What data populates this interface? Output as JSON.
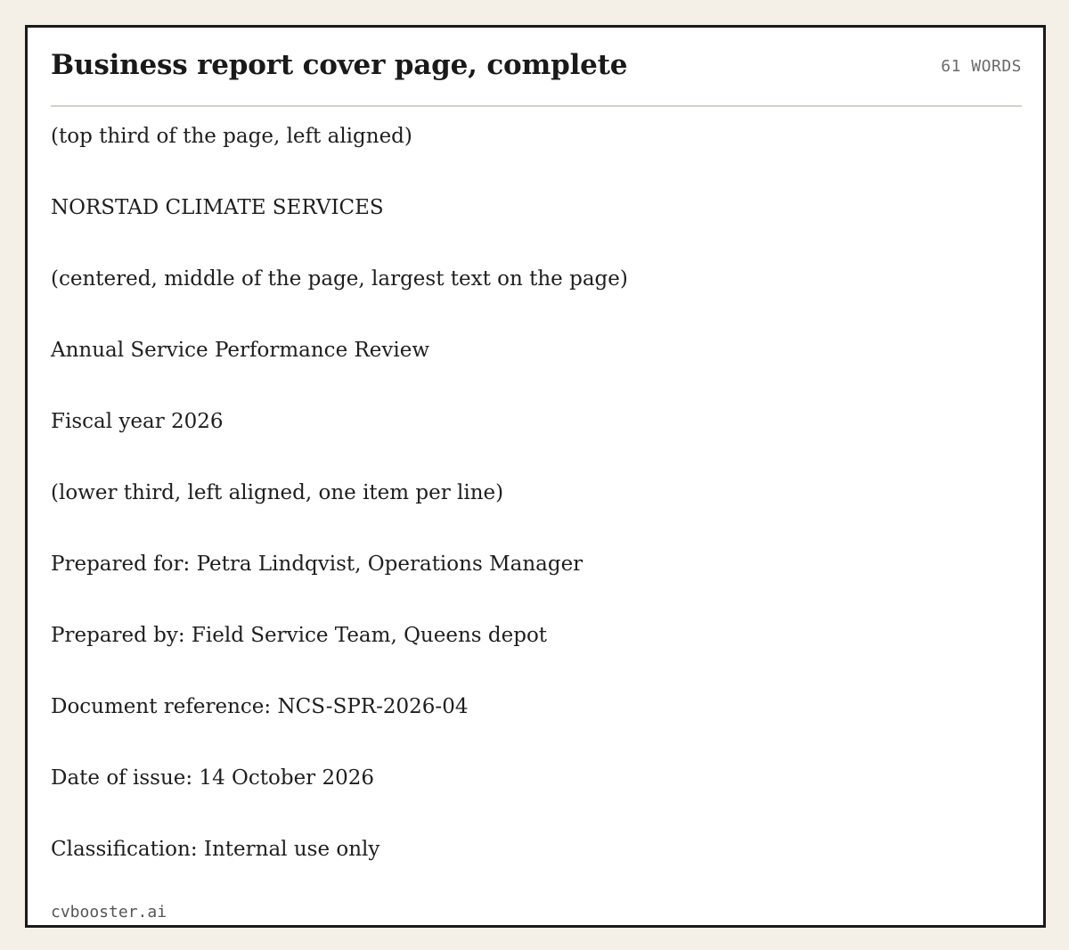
{
  "header": {
    "title": "Business report cover page, complete",
    "word_count": "61 WORDS"
  },
  "lines": [
    "(top third of the page, left aligned)",
    "NORSTAD CLIMATE SERVICES",
    "(centered, middle of the page, largest text on the page)",
    "Annual Service Performance Review",
    "Fiscal year 2026",
    "(lower third, left aligned, one item per line)",
    "Prepared for: Petra Lindqvist, Operations Manager",
    "Prepared by: Field Service Team, Queens depot",
    "Document reference: NCS-SPR-2026-04",
    "Date of issue: 14 October 2026",
    "Classification: Internal use only"
  ],
  "footer": {
    "brand": "cvbooster.ai"
  }
}
